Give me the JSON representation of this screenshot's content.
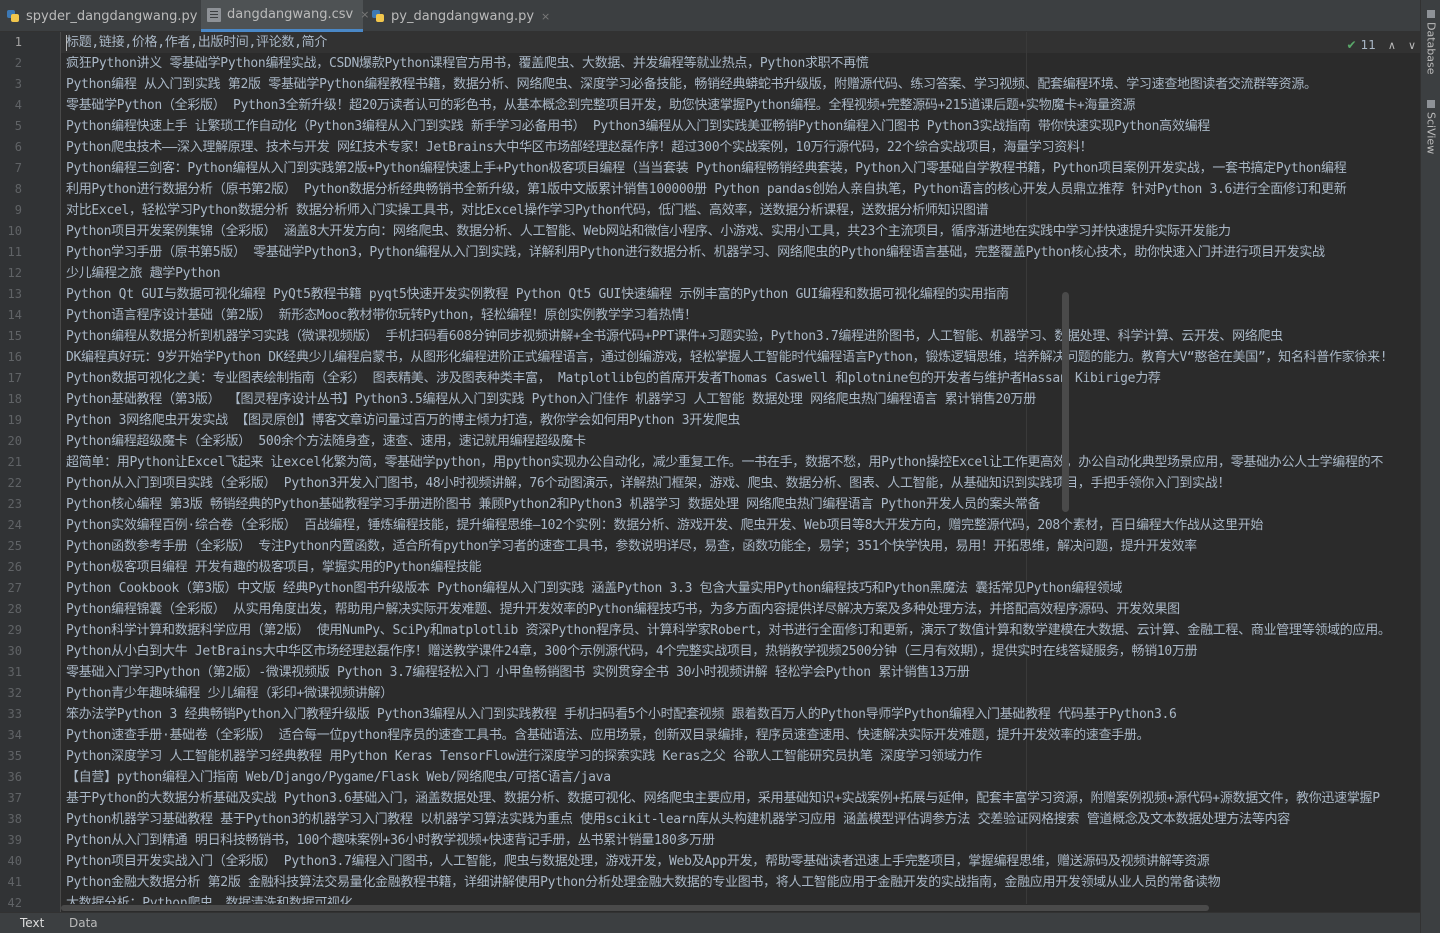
{
  "tabs": [
    {
      "label": "spyder_dangdangwang.py",
      "icon": "python-file-icon",
      "active": false
    },
    {
      "label": "dangdangwang.csv",
      "icon": "csv-file-icon",
      "active": true
    },
    {
      "label": "py_dangdangwang.py",
      "icon": "python-file-icon",
      "active": false
    }
  ],
  "tab_close_glyph": "×",
  "inspection": {
    "count": "11",
    "check": "✔",
    "up": "∧",
    "down": "∨"
  },
  "right_tools": [
    {
      "label": "Database",
      "icon": "database-icon"
    },
    {
      "label": "SciView",
      "icon": "sciview-icon"
    }
  ],
  "bottom_tabs": [
    {
      "label": "Text",
      "active": true
    },
    {
      "label": "Data",
      "active": false
    }
  ],
  "editor": {
    "current_line": 1,
    "line_numbers": [
      "1",
      "2",
      "3",
      "4",
      "5",
      "6",
      "7",
      "8",
      "9",
      "10",
      "11",
      "12",
      "13",
      "14",
      "15",
      "16",
      "17",
      "18",
      "19",
      "20",
      "21",
      "22",
      "23",
      "24",
      "25",
      "26",
      "27",
      "28",
      "29",
      "30",
      "31",
      "32",
      "33",
      "34",
      "35",
      "36",
      "37",
      "38",
      "39",
      "40",
      "41",
      "42"
    ],
    "lines": [
      "标题,链接,价格,作者,出版时间,评论数,简介",
      "疯狂Python讲义 零基础学Python编程实战，CSDN爆款Python课程官方用书，覆盖爬虫、大数据、并发编程等就业热点，Python求职不再慌",
      "Python编程 从入门到实践 第2版 零基础学Python编程教程书籍，数据分析、网络爬虫、深度学习必备技能，畅销经典蟒蛇书升级版，附赠源代码、练习答案、学习视频、配套编程环境、学习速查地图读者交流群等资源。",
      "零基础学Python（全彩版） Python3全新升级！超20万读者认可的彩色书，从基本概念到完整项目开发，助您快速掌握Python编程。全程视频+完整源码+215道课后题+实物魔卡+海量资源",
      "Python编程快速上手 让繁琐工作自动化（Python3编程从入门到实践 新手学习必备用书） Python3编程从入门到实践美亚畅销Python编程入门图书 Python3实战指南 带你快速实现Python高效编程",
      "Python爬虫技术——深入理解原理、技术与开发 网红技术专家！JetBrains大中华区市场部经理赵磊作序！超过300个实战案例，10万行源代码，22个综合实战项目，海量学习资料！",
      "Python编程三剑客：Python编程从入门到实践第2版+Python编程快速上手+Python极客项目编程（当当套装 Python编程畅销经典套装，Python入门零基础自学教程书籍，Python项目案例开发实战，一套书搞定Python编程",
      "利用Python进行数据分析（原书第2版） Python数据分析经典畅销书全新升级，第1版中文版累计销售100000册 Python pandas创始人亲自执笔，Python语言的核心开发人员鼎立推荐 针对Python 3.6进行全面修订和更新",
      "对比Excel，轻松学习Python数据分析 数据分析师入门实操工具书，对比Excel操作学习Python代码，低门槛、高效率，送数据分析课程，送数据分析师知识图谱",
      "Python项目开发案例集锦（全彩版） 涵盖8大开发方向：网络爬虫、数据分析、人工智能、Web网站和微信小程序、小游戏、实用小工具，共23个主流项目，循序渐进地在实践中学习并快速提升实际开发能力",
      "Python学习手册（原书第5版） 零基础学Python3，Python编程从入门到实践，详解利用Python进行数据分析、机器学习、网络爬虫的Python编程语言基础，完整覆盖Python核心技术，助你快速入门并进行项目开发实战",
      "少儿编程之旅 趣学Python",
      "Python Qt GUI与数据可视化编程 PyQt5教程书籍 pyqt5快速开发实例教程 Python Qt5 GUI快速编程 示例丰富的Python GUI编程和数据可视化编程的实用指南",
      "Python语言程序设计基础（第2版） 新形态Mooc教材带你玩转Python，轻松编程！原创实例教学学习着热情！",
      "Python编程从数据分析到机器学习实践（微课视频版） 手机扫码看608分钟同步视频讲解+全书源代码+PPT课件+习题实验，Python3.7编程进阶图书，人工智能、机器学习、数据处理、科学计算、云开发、网络爬虫",
      "DK编程真好玩：9岁开始学Python DK经典少儿编程启蒙书，从图形化编程进阶正式编程语言，通过创编游戏，轻松掌握人工智能时代编程语言Python，锻炼逻辑思维，培养解决问题的能力。教育大V“憨爸在美国”，知名科普作家徐来!",
      "Python数据可视化之美：专业图表绘制指南（全彩） 图表精美、涉及图表种类丰富， Matplotlib包的首席开发者Thomas Caswell 和plotnine包的开发者与维护者Hassan Kibirige力荐",
      "Python基础教程（第3版） 【图灵程序设计丛书】Python3.5编程从入门到实践 Python入门佳作 机器学习 人工智能 数据处理 网络爬虫热门编程语言 累计销售20万册",
      "Python 3网络爬虫开发实战 【图灵原创】博客文章访问量过百万的博主倾力打造，教你学会如何用Python 3开发爬虫",
      "Python编程超级魔卡（全彩版） 500余个方法随身查，速查、速用，速记就用编程超级魔卡",
      "超简单：用Python让Excel飞起来 让excel化繁为简，零基础学python，用python实现办公自动化，减少重复工作。一书在手，数据不愁，用Python操控Excel让工作更高效，办公自动化典型场景应用，零基础办公人士学编程的不",
      "Python从入门到项目实践（全彩版） Python3开发入门图书，48小时视频讲解，76个动图演示，详解热门框架，游戏、爬虫、数据分析、图表、人工智能，从基础知识到实践项目，手把手领你入门到实战！",
      "Python核心编程 第3版 畅销经典的Python基础教程学习手册进阶图书 兼顾Python2和Python3 机器学习 数据处理 网络爬虫热门编程语言 Python开发人员的案头常备",
      "Python实效编程百例·综合卷（全彩版） 百战编程，锤炼编程技能，提升编程思维—102个实例：数据分析、游戏开发、爬虫开发、Web项目等8大开发方向，赠完整源代码，208个素材，百日编程大作战从这里开始",
      "Python函数参考手册（全彩版） 专注Python内置函数，适合所有python学习者的速查工具书，参数说明详尽，易查，函数功能全，易学；351个快学快用，易用！开拓思维，解决问题，提升开发效率",
      "Python极客项目编程 开发有趣的极客项目，掌握实用的Python编程技能",
      "Python Cookbook（第3版）中文版 经典Python图书升级版本 Python编程从入门到实践 涵盖Python 3.3 包含大量实用Python编程技巧和Python黑魔法 囊括常见Python编程领域",
      "Python编程锦囊（全彩版） 从实用角度出发，帮助用户解决实际开发难题、提升开发效率的Python编程技巧书，为多方面内容提供详尽解决方案及多种处理方法，并搭配高效程序源码、开发效果图",
      "Python科学计算和数据科学应用（第2版） 使用NumPy、SciPy和matplotlib 资深Python程序员、计算科学家Robert，对书进行全面修订和更新，演示了数值计算和数学建模在大数据、云计算、金融工程、商业管理等领域的应用。",
      "Python从小白到大牛 JetBrains大中华区市场经理赵磊作序！赠送教学课件24章，300个示例源代码，4个完整实战项目，热销教学视频2500分钟（三月有效期），提供实时在线答疑服务，畅销10万册",
      "零基础入门学习Python（第2版）-微课视频版 Python 3.7编程轻松入门 小甲鱼畅销图书 实例贯穿全书 30小时视频讲解 轻松学会Python 累计销售13万册",
      "Python青少年趣味编程 少儿编程（彩印+微课视频讲解）",
      "笨办法学Python 3 经典畅销Python入门教程升级版 Python3编程从入门到实践教程 手机扫码看5个小时配套视频 跟着数百万人的Python导师学Python编程入门基础教程 代码基于Python3.6",
      "Python速查手册·基础卷（全彩版） 适合每一位python程序员的速查工具书。含基础语法、应用场景，创新双目录编排，程序员速查速用、快速解决实际开发难题，提升开发效率的速查手册。",
      "Python深度学习 人工智能机器学习经典教程 用Python Keras TensorFlow进行深度学习的探索实践 Keras之父 谷歌人工智能研究员执笔 深度学习领域力作",
      "【自营】python编程入门指南 Web/Django/Pygame/Flask Web/网络爬虫/可搭C语言/java",
      "基于Python的大数据分析基础及实战 Python3.6基础入门，涵盖数据处理、数据分析、数据可视化、网络爬虫主要应用，采用基础知识+实战案例+拓展与延伸，配套丰富学习资源，附赠案例视频+源代码+源数据文件，教你迅速掌握P",
      "Python机器学习基础教程 基于Python3的机器学习入门教程 以机器学习算法实践为重点 使用scikit-learn库从头构建机器学习应用 涵盖模型评估调参方法 交差验证网格搜索 管道概念及文本数据处理方法等内容",
      "Python从入门到精通 明日科技畅销书，100个趣味案例+36小时教学视频+快速背记手册，丛书累计销量180多万册",
      "Python项目开发实战入门（全彩版） Python3.7编程入门图书，人工智能，爬虫与数据处理，游戏开发，Web及App开发，帮助零基础读者迅速上手完整项目，掌握编程思维，赠送源码及视频讲解等资源",
      "Python金融大数据分析 第2版 金融科技算法交易量化金融教程书籍，详细讲解使用Python分析处理金融大数据的专业图书，将人工智能应用于金融开发的实战指南，金融应用开发领域从业人员的常备读物",
      "大数据分析：Python爬虫、数据清洗和数据可视化"
    ]
  }
}
